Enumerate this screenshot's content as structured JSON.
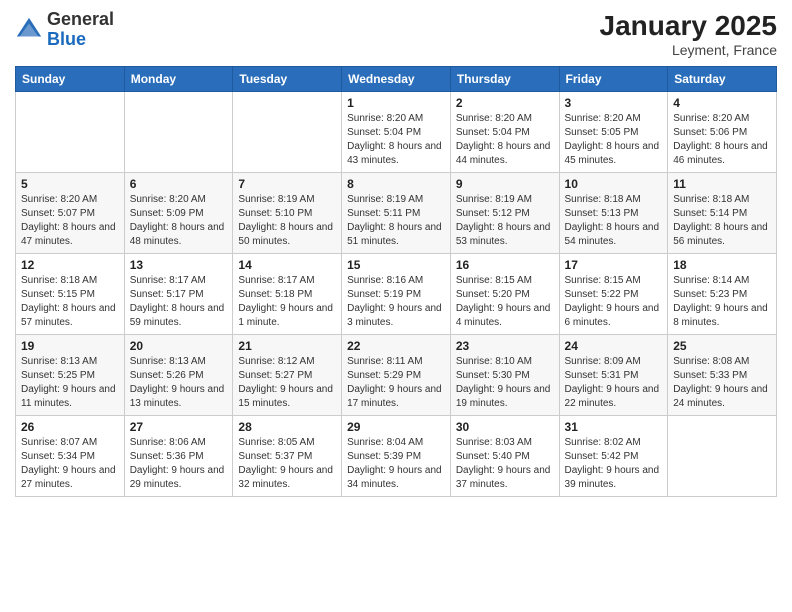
{
  "header": {
    "logo_general": "General",
    "logo_blue": "Blue",
    "month_year": "January 2025",
    "location": "Leyment, France"
  },
  "days_of_week": [
    "Sunday",
    "Monday",
    "Tuesday",
    "Wednesday",
    "Thursday",
    "Friday",
    "Saturday"
  ],
  "weeks": [
    [
      {
        "day": "",
        "sunrise": "",
        "sunset": "",
        "daylight": ""
      },
      {
        "day": "",
        "sunrise": "",
        "sunset": "",
        "daylight": ""
      },
      {
        "day": "",
        "sunrise": "",
        "sunset": "",
        "daylight": ""
      },
      {
        "day": "1",
        "sunrise": "Sunrise: 8:20 AM",
        "sunset": "Sunset: 5:04 PM",
        "daylight": "Daylight: 8 hours and 43 minutes."
      },
      {
        "day": "2",
        "sunrise": "Sunrise: 8:20 AM",
        "sunset": "Sunset: 5:04 PM",
        "daylight": "Daylight: 8 hours and 44 minutes."
      },
      {
        "day": "3",
        "sunrise": "Sunrise: 8:20 AM",
        "sunset": "Sunset: 5:05 PM",
        "daylight": "Daylight: 8 hours and 45 minutes."
      },
      {
        "day": "4",
        "sunrise": "Sunrise: 8:20 AM",
        "sunset": "Sunset: 5:06 PM",
        "daylight": "Daylight: 8 hours and 46 minutes."
      }
    ],
    [
      {
        "day": "5",
        "sunrise": "Sunrise: 8:20 AM",
        "sunset": "Sunset: 5:07 PM",
        "daylight": "Daylight: 8 hours and 47 minutes."
      },
      {
        "day": "6",
        "sunrise": "Sunrise: 8:20 AM",
        "sunset": "Sunset: 5:09 PM",
        "daylight": "Daylight: 8 hours and 48 minutes."
      },
      {
        "day": "7",
        "sunrise": "Sunrise: 8:19 AM",
        "sunset": "Sunset: 5:10 PM",
        "daylight": "Daylight: 8 hours and 50 minutes."
      },
      {
        "day": "8",
        "sunrise": "Sunrise: 8:19 AM",
        "sunset": "Sunset: 5:11 PM",
        "daylight": "Daylight: 8 hours and 51 minutes."
      },
      {
        "day": "9",
        "sunrise": "Sunrise: 8:19 AM",
        "sunset": "Sunset: 5:12 PM",
        "daylight": "Daylight: 8 hours and 53 minutes."
      },
      {
        "day": "10",
        "sunrise": "Sunrise: 8:18 AM",
        "sunset": "Sunset: 5:13 PM",
        "daylight": "Daylight: 8 hours and 54 minutes."
      },
      {
        "day": "11",
        "sunrise": "Sunrise: 8:18 AM",
        "sunset": "Sunset: 5:14 PM",
        "daylight": "Daylight: 8 hours and 56 minutes."
      }
    ],
    [
      {
        "day": "12",
        "sunrise": "Sunrise: 8:18 AM",
        "sunset": "Sunset: 5:15 PM",
        "daylight": "Daylight: 8 hours and 57 minutes."
      },
      {
        "day": "13",
        "sunrise": "Sunrise: 8:17 AM",
        "sunset": "Sunset: 5:17 PM",
        "daylight": "Daylight: 8 hours and 59 minutes."
      },
      {
        "day": "14",
        "sunrise": "Sunrise: 8:17 AM",
        "sunset": "Sunset: 5:18 PM",
        "daylight": "Daylight: 9 hours and 1 minute."
      },
      {
        "day": "15",
        "sunrise": "Sunrise: 8:16 AM",
        "sunset": "Sunset: 5:19 PM",
        "daylight": "Daylight: 9 hours and 3 minutes."
      },
      {
        "day": "16",
        "sunrise": "Sunrise: 8:15 AM",
        "sunset": "Sunset: 5:20 PM",
        "daylight": "Daylight: 9 hours and 4 minutes."
      },
      {
        "day": "17",
        "sunrise": "Sunrise: 8:15 AM",
        "sunset": "Sunset: 5:22 PM",
        "daylight": "Daylight: 9 hours and 6 minutes."
      },
      {
        "day": "18",
        "sunrise": "Sunrise: 8:14 AM",
        "sunset": "Sunset: 5:23 PM",
        "daylight": "Daylight: 9 hours and 8 minutes."
      }
    ],
    [
      {
        "day": "19",
        "sunrise": "Sunrise: 8:13 AM",
        "sunset": "Sunset: 5:25 PM",
        "daylight": "Daylight: 9 hours and 11 minutes."
      },
      {
        "day": "20",
        "sunrise": "Sunrise: 8:13 AM",
        "sunset": "Sunset: 5:26 PM",
        "daylight": "Daylight: 9 hours and 13 minutes."
      },
      {
        "day": "21",
        "sunrise": "Sunrise: 8:12 AM",
        "sunset": "Sunset: 5:27 PM",
        "daylight": "Daylight: 9 hours and 15 minutes."
      },
      {
        "day": "22",
        "sunrise": "Sunrise: 8:11 AM",
        "sunset": "Sunset: 5:29 PM",
        "daylight": "Daylight: 9 hours and 17 minutes."
      },
      {
        "day": "23",
        "sunrise": "Sunrise: 8:10 AM",
        "sunset": "Sunset: 5:30 PM",
        "daylight": "Daylight: 9 hours and 19 minutes."
      },
      {
        "day": "24",
        "sunrise": "Sunrise: 8:09 AM",
        "sunset": "Sunset: 5:31 PM",
        "daylight": "Daylight: 9 hours and 22 minutes."
      },
      {
        "day": "25",
        "sunrise": "Sunrise: 8:08 AM",
        "sunset": "Sunset: 5:33 PM",
        "daylight": "Daylight: 9 hours and 24 minutes."
      }
    ],
    [
      {
        "day": "26",
        "sunrise": "Sunrise: 8:07 AM",
        "sunset": "Sunset: 5:34 PM",
        "daylight": "Daylight: 9 hours and 27 minutes."
      },
      {
        "day": "27",
        "sunrise": "Sunrise: 8:06 AM",
        "sunset": "Sunset: 5:36 PM",
        "daylight": "Daylight: 9 hours and 29 minutes."
      },
      {
        "day": "28",
        "sunrise": "Sunrise: 8:05 AM",
        "sunset": "Sunset: 5:37 PM",
        "daylight": "Daylight: 9 hours and 32 minutes."
      },
      {
        "day": "29",
        "sunrise": "Sunrise: 8:04 AM",
        "sunset": "Sunset: 5:39 PM",
        "daylight": "Daylight: 9 hours and 34 minutes."
      },
      {
        "day": "30",
        "sunrise": "Sunrise: 8:03 AM",
        "sunset": "Sunset: 5:40 PM",
        "daylight": "Daylight: 9 hours and 37 minutes."
      },
      {
        "day": "31",
        "sunrise": "Sunrise: 8:02 AM",
        "sunset": "Sunset: 5:42 PM",
        "daylight": "Daylight: 9 hours and 39 minutes."
      },
      {
        "day": "",
        "sunrise": "",
        "sunset": "",
        "daylight": ""
      }
    ]
  ]
}
